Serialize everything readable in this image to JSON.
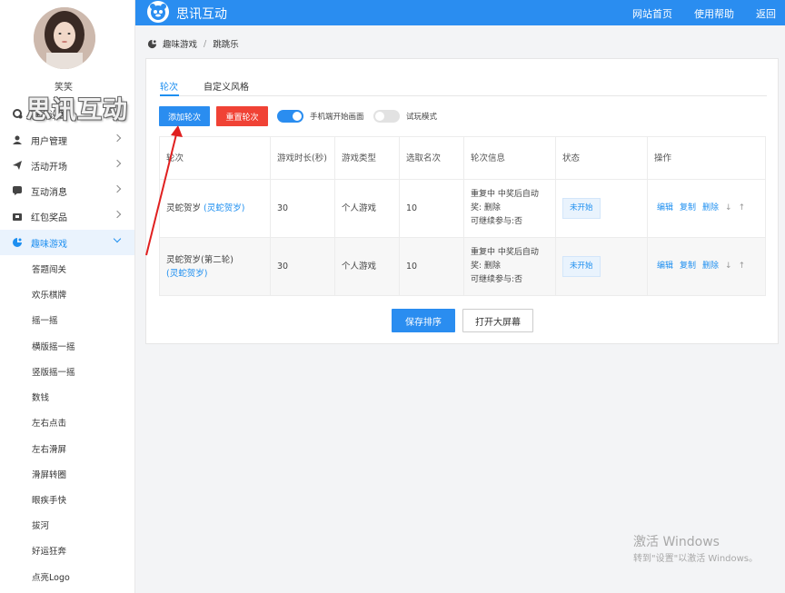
{
  "brand": {
    "name": "思讯互动",
    "watermark": "思讯互动",
    "color": "#2a8df0"
  },
  "header": {
    "links": [
      "网站首页",
      "使用帮助",
      "返回"
    ]
  },
  "user": {
    "name": "笑笑"
  },
  "sidebar": {
    "items": [
      {
        "label": "基本设置",
        "icon": "gear-icon"
      },
      {
        "label": "用户管理",
        "icon": "user-icon"
      },
      {
        "label": "活动开场",
        "icon": "send-icon"
      },
      {
        "label": "互动消息",
        "icon": "message-icon"
      },
      {
        "label": "红包奖品",
        "icon": "gift-icon"
      },
      {
        "label": "趣味游戏",
        "icon": "game-icon",
        "active": true
      }
    ],
    "subitems": [
      "答题闯关",
      "欢乐棋牌",
      "摇一摇",
      "横版摇一摇",
      "竖版摇一摇",
      "数钱",
      "左右点击",
      "左右滑屏",
      "滑屏转圈",
      "眼疾手快",
      "拔河",
      "好运狂奔",
      "点亮Logo"
    ]
  },
  "breadcrumb": {
    "parent": "趣味游戏",
    "sep": "/",
    "current": "跳跳乐"
  },
  "tabs": [
    "轮次",
    "自定义风格"
  ],
  "toolbar": {
    "add_label": "添加轮次",
    "reset_label": "重置轮次",
    "mobile_start_label": "手机端开始画面",
    "mobile_start_on": true,
    "trial_label": "试玩模式",
    "trial_on": false
  },
  "table": {
    "headers": [
      "轮次",
      "游戏时长(秒)",
      "游戏类型",
      "选取名次",
      "轮次信息",
      "状态",
      "操作"
    ],
    "rows": [
      {
        "round": "灵蛇贺岁",
        "round_link": "(灵蛇贺岁)",
        "suffix": "",
        "duration": "30",
        "type": "个人游戏",
        "rank": "10",
        "info": [
          "重复中   中奖后自动",
          "奖:        删除",
          "可继续参与:否"
        ],
        "status": "未开始",
        "ops": [
          "编辑",
          "复制",
          "删除",
          "↓",
          "↑"
        ]
      },
      {
        "round": "灵蛇贺岁(第二轮)",
        "round_link": "(灵蛇贺岁)",
        "suffix": "",
        "duration": "30",
        "type": "个人游戏",
        "rank": "10",
        "info": [
          "重复中   中奖后自动",
          "奖:        删除",
          "可继续参与:否"
        ],
        "status": "未开始",
        "ops": [
          "编辑",
          "复制",
          "删除",
          "↓",
          "↑"
        ]
      }
    ]
  },
  "footer_buttons": {
    "save": "保存排序",
    "bigscreen": "打开大屏幕"
  },
  "windows": {
    "line1": "激活 Windows",
    "line2": "转到\"设置\"以激活 Windows。"
  }
}
